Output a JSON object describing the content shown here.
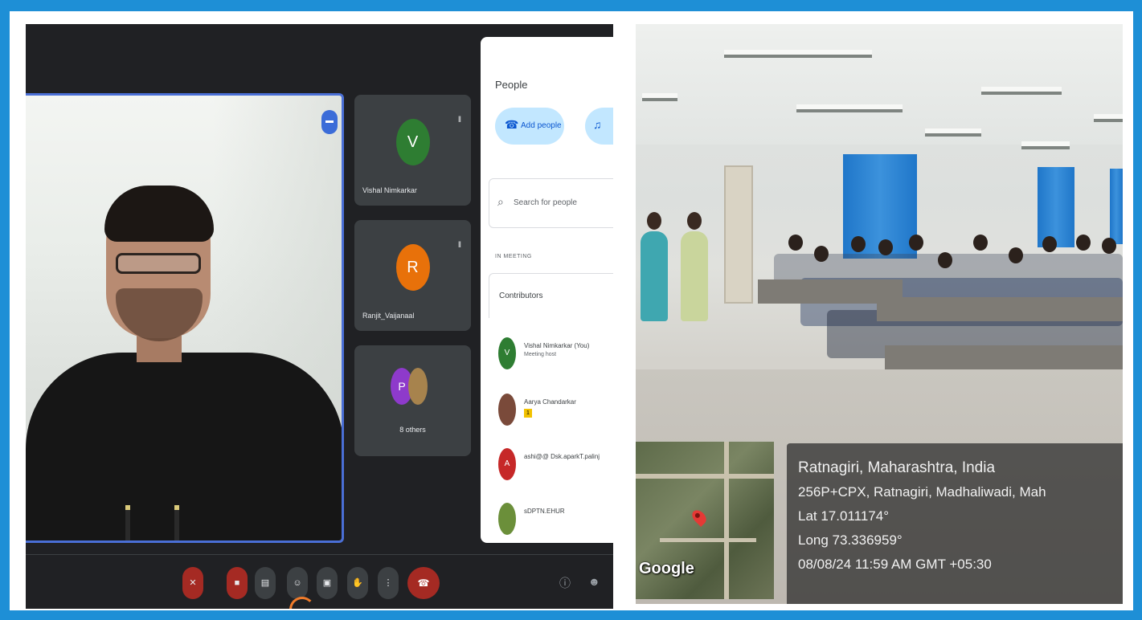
{
  "meeting": {
    "tiles": [
      {
        "initial": "V",
        "name": "Vishal Nimkarkar",
        "color": "#2e7d32"
      },
      {
        "initial": "R",
        "name": "Ranjit_Vaijanaal",
        "color": "#e8710a"
      }
    ],
    "others": {
      "initial": "P",
      "label": "8 others"
    },
    "people_panel": {
      "title": "People",
      "add_label": "Add people",
      "search_placeholder": "Search for people",
      "section_label": "IN MEETING",
      "section_row": "Contributors",
      "participants": [
        {
          "initial": "V",
          "name": "Vishal Nimkarkar (You)",
          "sub": "Meeting host",
          "color": "#2e7d32"
        },
        {
          "initial": "",
          "name": "Aarya Chandarkar",
          "badge": "1",
          "color": "#7a4a3a"
        },
        {
          "initial": "A",
          "name": "ashi@@ Dsk.aparkT.palinj",
          "color": "#c62828"
        },
        {
          "initial": "",
          "name": "sDPTN.EHUR",
          "color": "#6b8f3a"
        }
      ]
    },
    "toolbar_icons": [
      "mic-off-icon",
      "camera-off-icon",
      "captions-icon",
      "emoji-icon",
      "present-icon",
      "raise-hand-icon",
      "more-icon",
      "end-call-icon",
      "info-icon",
      "people-icon"
    ]
  },
  "geotag": {
    "place": "Ratnagiri, Maharashtra, India",
    "address": "256P+CPX, Ratnagiri, Madhaliwadi, Mah",
    "lat": "Lat 17.011174°",
    "long": "Long 73.336959°",
    "datetime": "08/08/24 11:59 AM GMT +05:30",
    "map_logo": "Google"
  },
  "colors": {
    "frame": "#1e8fd6",
    "meet_bg": "#202124",
    "accent": "#0b57d0",
    "end_call": "#a52a23"
  }
}
